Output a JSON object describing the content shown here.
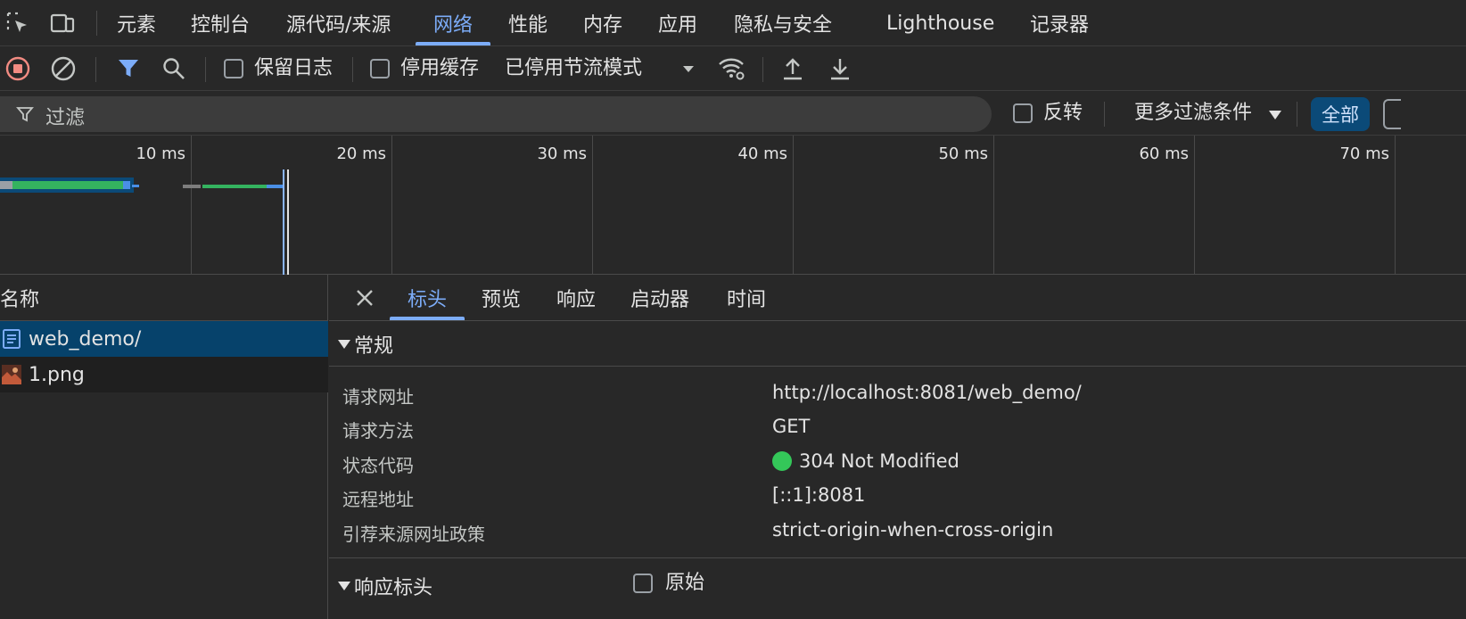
{
  "top_tabs": [
    {
      "label": "元素"
    },
    {
      "label": "控制台"
    },
    {
      "label": "源代码/来源"
    },
    {
      "label": "网络"
    },
    {
      "label": "性能"
    },
    {
      "label": "内存"
    },
    {
      "label": "应用"
    },
    {
      "label": "隐私与安全"
    },
    {
      "label": "Lighthouse"
    },
    {
      "label": "记录器"
    }
  ],
  "toolbar": {
    "preserve_log": "保留日志",
    "disable_cache": "停用缓存",
    "throttling": "已停用节流模式"
  },
  "filter": {
    "placeholder": "过滤",
    "invert": "反转",
    "more_filters": "更多过滤条件",
    "all": "全部"
  },
  "overview": {
    "ticks": [
      "10 ms",
      "20 ms",
      "30 ms",
      "40 ms",
      "50 ms",
      "60 ms",
      "70 ms"
    ]
  },
  "requests": {
    "header": "名称",
    "rows": [
      {
        "name": "web_demo/",
        "icon": "document-icon"
      },
      {
        "name": "1.png",
        "icon": "image-thumbnail"
      }
    ]
  },
  "detail": {
    "tabs": [
      "标头",
      "预览",
      "响应",
      "启动器",
      "时间"
    ],
    "general": {
      "title": "常规",
      "rows": [
        {
          "key": "请求网址",
          "value": "http://localhost:8081/web_demo/"
        },
        {
          "key": "请求方法",
          "value": "GET"
        },
        {
          "key": "状态代码",
          "value": "304 Not Modified"
        },
        {
          "key": "远程地址",
          "value": "[::1]:8081"
        },
        {
          "key": "引荐来源网址政策",
          "value": "strict-origin-when-cross-origin"
        }
      ]
    },
    "response_headers": {
      "title": "响应标头",
      "raw": "原始"
    }
  },
  "colors": {
    "accent": "#7cacf8",
    "selected_row": "#06426b",
    "status_ok": "#34c759",
    "record_red": "#f28b82"
  }
}
